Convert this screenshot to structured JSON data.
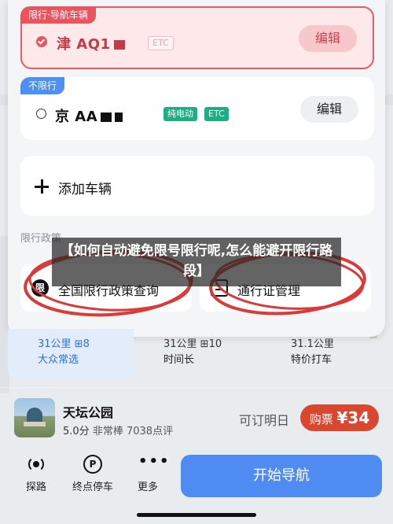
{
  "vehicles": {
    "restricted": {
      "tag": "限行·导航车辆",
      "plate": "津 AQ1",
      "badge": "ETC",
      "edit_label": "编辑"
    },
    "unrestricted": {
      "tag": "不限行",
      "plate": "京 AA",
      "badge_ev": "纯电动",
      "badge_etc": "ETC",
      "edit_label": "编辑"
    },
    "add_label": "添加车辆"
  },
  "policy": {
    "section_title": "限行政策",
    "national_icon": "限",
    "national_label": "全国限行政策查询",
    "permit_label": "通行证管理"
  },
  "overlay_banner": "【如何自动避免限号限行呢,怎么能避开限行路段】",
  "routes": [
    {
      "meta": "31公里 ⊞8",
      "desc": "大众常选"
    },
    {
      "meta": "31公里 ⊞10",
      "desc": "时间长"
    },
    {
      "meta": "31.1公里",
      "desc": "特价打车"
    }
  ],
  "poi": {
    "name": "天坛公园",
    "score": "5.0分",
    "rating_desc": "非常棒",
    "reviews": "7038点评",
    "reserve_label": "可订明日",
    "buy_label": "购票",
    "price": "¥34"
  },
  "toolbar": {
    "explore_label": "探路",
    "parking_label": "终点停车",
    "more_label": "更多",
    "parking_icon_glyph": "P",
    "more_icon_glyph": "•••",
    "start_label": "开始导航"
  },
  "colors": {
    "accent_blue": "#4f8cf1",
    "restrict_red": "#e9545f",
    "ev_green": "#1fae7f",
    "buy_red": "#d9472f"
  }
}
